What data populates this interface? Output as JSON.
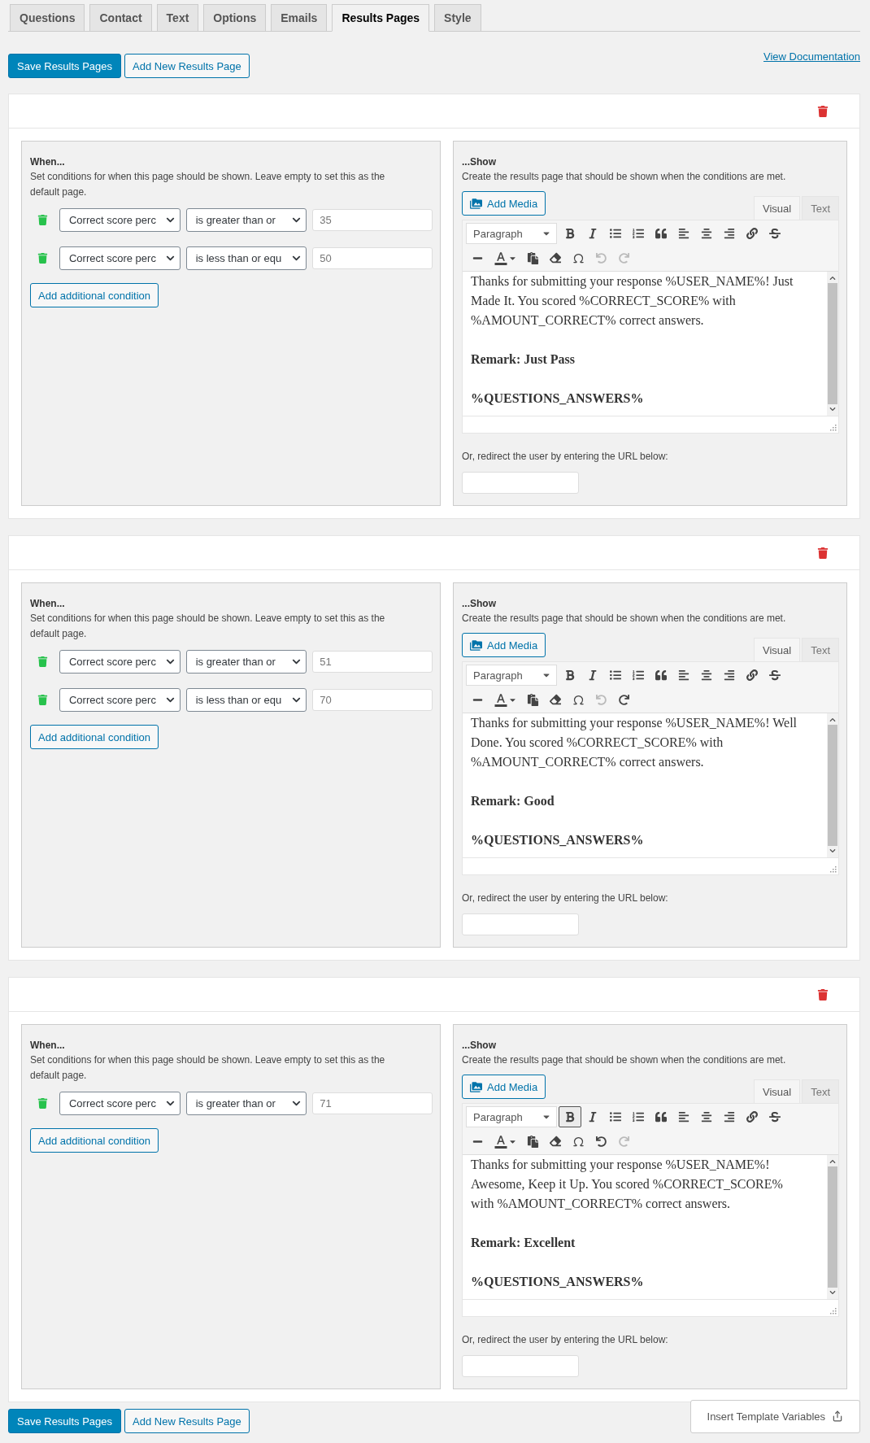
{
  "tabs": [
    {
      "label": "Questions",
      "selected": false
    },
    {
      "label": "Contact",
      "selected": false
    },
    {
      "label": "Text",
      "selected": false
    },
    {
      "label": "Options",
      "selected": false
    },
    {
      "label": "Emails",
      "selected": false
    },
    {
      "label": "Results Pages",
      "selected": true
    },
    {
      "label": "Style",
      "selected": false
    }
  ],
  "actions": {
    "save_button": "Save Results Pages",
    "add_button": "Add New Results Page",
    "documentation_link": "View Documentation"
  },
  "results_pages": [
    {
      "when": {
        "title": "When...",
        "description": "Set conditions for when this page should be shown. Leave empty to set this as the default page.",
        "conditions": [
          {
            "field": "Correct score perc",
            "operator": "is greater than or",
            "value": "35"
          },
          {
            "field": "Correct score perc",
            "operator": "is less than or equ",
            "value": "50"
          }
        ],
        "add_condition": "Add additional condition"
      },
      "show": {
        "title": "...Show",
        "description": "Create the results page that should be shown when the conditions are met.",
        "add_media": "Add Media",
        "editor_tabs": [
          {
            "label": "Visual",
            "selected": true
          },
          {
            "label": "Text",
            "selected": false
          }
        ],
        "format": "Paragraph",
        "bold_active": false,
        "undo_enabled": false,
        "redo_enabled": false,
        "paragraphs": [
          {
            "text": "Thanks for submitting your response %USER_NAME%! Just Made It. You scored %CORRECT_SCORE% with %AMOUNT_CORRECT% correct answers.",
            "bold": false
          },
          {
            "text": "Remark: Just Pass",
            "bold": true
          },
          {
            "text": "%QUESTIONS_ANSWERS%",
            "bold": true
          }
        ],
        "redirect_label": "Or, redirect the user by entering the URL below:"
      }
    },
    {
      "when": {
        "title": "When...",
        "description": "Set conditions for when this page should be shown. Leave empty to set this as the default page.",
        "conditions": [
          {
            "field": "Correct score perc",
            "operator": "is greater than or",
            "value": "51"
          },
          {
            "field": "Correct score perc",
            "operator": "is less than or equ",
            "value": "70"
          }
        ],
        "add_condition": "Add additional condition"
      },
      "show": {
        "title": "...Show",
        "description": "Create the results page that should be shown when the conditions are met.",
        "add_media": "Add Media",
        "editor_tabs": [
          {
            "label": "Visual",
            "selected": true
          },
          {
            "label": "Text",
            "selected": false
          }
        ],
        "format": "Paragraph",
        "bold_active": false,
        "undo_enabled": false,
        "redo_enabled": true,
        "paragraphs": [
          {
            "text": "Thanks for submitting your response %USER_NAME%! Well Done. You scored %CORRECT_SCORE% with %AMOUNT_CORRECT% correct answers.",
            "bold": false
          },
          {
            "text": "Remark: Good",
            "bold": true
          },
          {
            "text": "%QUESTIONS_ANSWERS%",
            "bold": true
          }
        ],
        "redirect_label": "Or, redirect the user by entering the URL below:"
      }
    },
    {
      "when": {
        "title": "When...",
        "description": "Set conditions for when this page should be shown. Leave empty to set this as the default page.",
        "conditions": [
          {
            "field": "Correct score perc",
            "operator": "is greater than or",
            "value": "71"
          }
        ],
        "add_condition": "Add additional condition"
      },
      "show": {
        "title": "...Show",
        "description": "Create the results page that should be shown when the conditions are met.",
        "add_media": "Add Media",
        "editor_tabs": [
          {
            "label": "Visual",
            "selected": true
          },
          {
            "label": "Text",
            "selected": false
          }
        ],
        "format": "Paragraph",
        "bold_active": true,
        "undo_enabled": true,
        "redo_enabled": false,
        "paragraphs": [
          {
            "text": "Thanks for submitting your response %USER_NAME%! Awesome, Keep it Up. You scored %CORRECT_SCORE% with %AMOUNT_CORRECT% correct answers.",
            "bold": false
          },
          {
            "text": "Remark: Excellent",
            "bold": true
          },
          {
            "text": "%QUESTIONS_ANSWERS%",
            "bold": true
          }
        ],
        "redirect_label": "Or, redirect the user by entering the URL below:"
      }
    }
  ],
  "footer": {
    "save_button": "Save Results Pages",
    "add_button": "Add New Results Page",
    "insert_variables": "Insert Template Variables"
  }
}
